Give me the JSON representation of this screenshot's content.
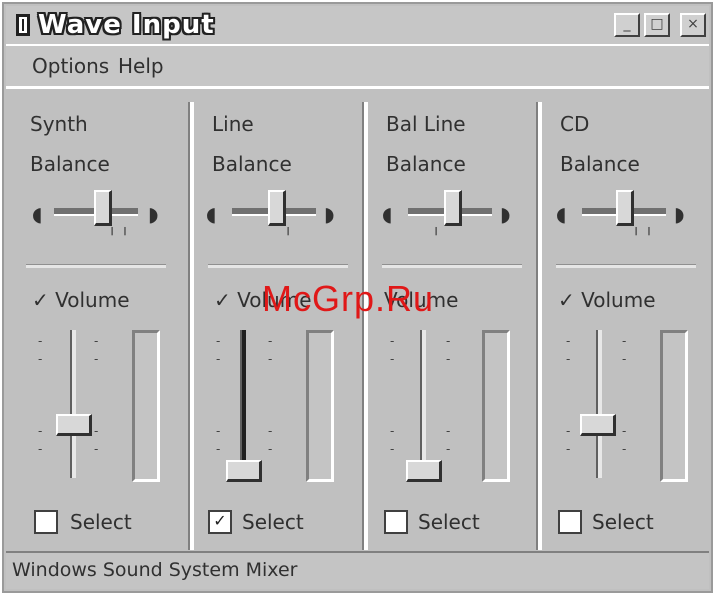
{
  "window": {
    "title": "Wave Input",
    "buttons": {
      "minimize": "_",
      "maximize": "□",
      "close": "×"
    }
  },
  "menu": {
    "options": "Options",
    "help": "Help"
  },
  "channels": [
    {
      "name": "Synth",
      "balance_label": "Balance",
      "volume_label": "Volume",
      "volume_checked": true,
      "volume_level": 0.35,
      "select_label": "Select",
      "select_checked": false
    },
    {
      "name": "Line",
      "balance_label": "Balance",
      "volume_label": "Volume",
      "volume_checked": true,
      "volume_level": 0.0,
      "select_label": "Select",
      "select_checked": true
    },
    {
      "name": "Bal Line",
      "balance_label": "Balance",
      "volume_label": "Volume",
      "volume_checked": false,
      "volume_level": 0.0,
      "select_label": "Select",
      "select_checked": false
    },
    {
      "name": "CD",
      "balance_label": "Balance",
      "volume_label": "Volume",
      "volume_checked": true,
      "volume_level": 0.35,
      "select_label": "Select",
      "select_checked": false
    }
  ],
  "status": "Windows Sound System Mixer",
  "watermark": "McGrp.Ru",
  "colors": {
    "face": "#c0c0c0",
    "watermark": "#e01818"
  }
}
